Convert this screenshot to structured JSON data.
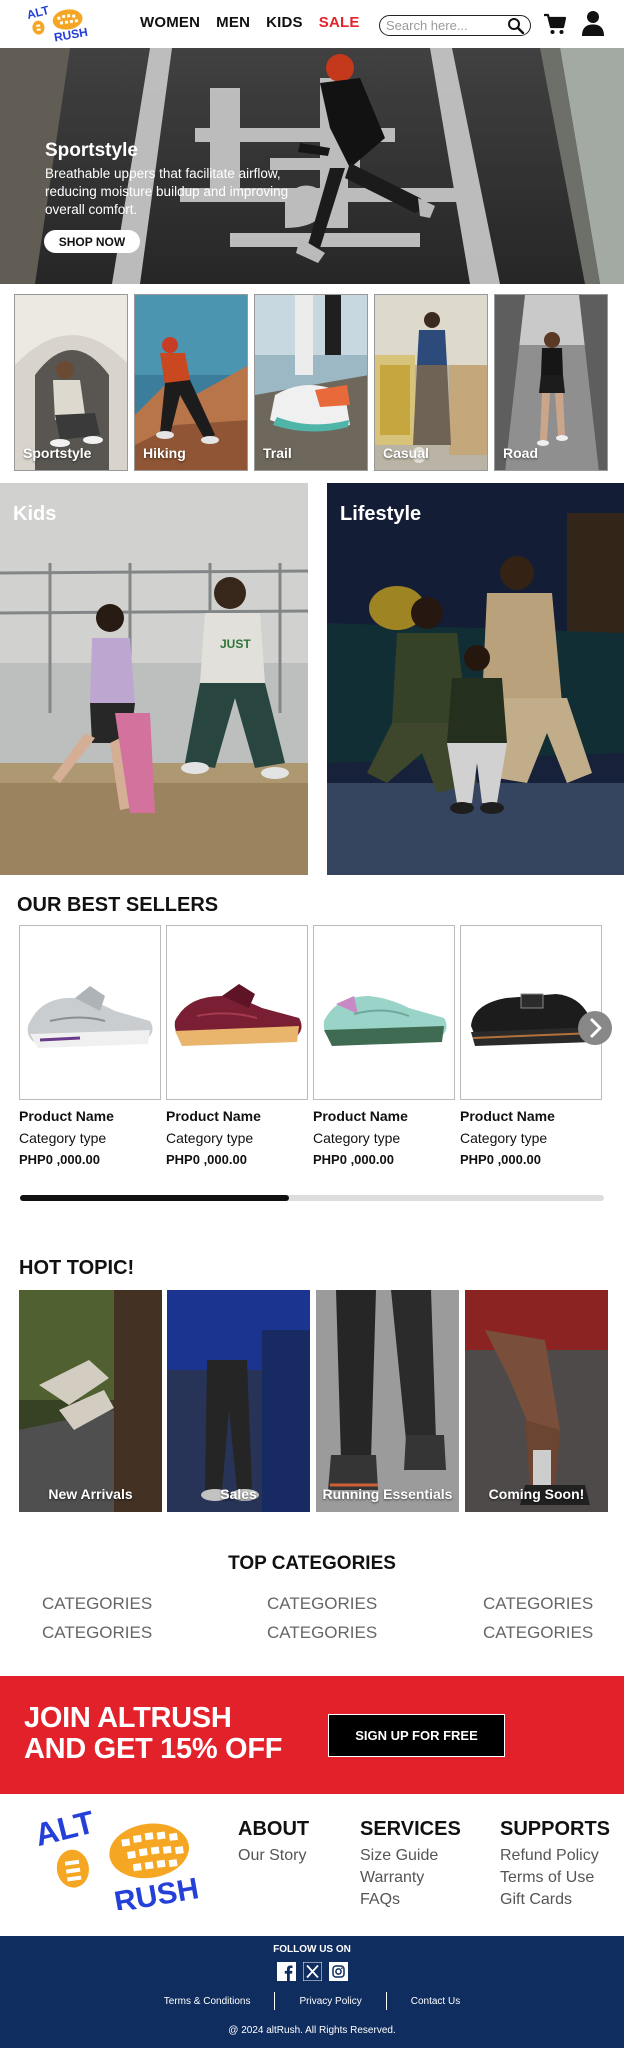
{
  "header": {
    "logo_text_top": "ALT",
    "logo_text_bottom": "RUSH",
    "nav": [
      "WOMEN",
      "MEN",
      "KIDS",
      "SALE"
    ],
    "search_placeholder": "Search here...",
    "icons": [
      "search-icon",
      "cart-icon",
      "user-icon"
    ]
  },
  "hero": {
    "title": "Sportstyle",
    "description": "Breathable uppers that facilitate airflow, reducing moisture buildup and improving overall comfort.",
    "cta": "SHOP NOW"
  },
  "activities": [
    "Sportstyle",
    "Hiking",
    "Trail",
    "Casual",
    "Road"
  ],
  "featured": {
    "left": "Kids",
    "right": "Lifestyle"
  },
  "best_sellers": {
    "title": "OUR BEST SELLERS",
    "products": [
      {
        "name": "Product Name",
        "category": "Category type",
        "price": "PHP0 ,000.00"
      },
      {
        "name": "Product Name",
        "category": "Category type",
        "price": "PHP0 ,000.00"
      },
      {
        "name": "Product Name",
        "category": "Category type",
        "price": "PHP0 ,000.00"
      },
      {
        "name": "Product Name",
        "category": "Category type",
        "price": "PHP0 ,000.00"
      }
    ],
    "scroll_progress": 0.46
  },
  "hot_topic": {
    "title": "HOT TOPIC!",
    "items": [
      "New Arrivals",
      "Sales",
      "Running Essentials",
      "Coming Soon!"
    ]
  },
  "top_categories": {
    "title": "TOP CATEGORIES",
    "items": [
      "CATEGORIES",
      "CATEGORIES",
      "CATEGORIES",
      "CATEGORIES",
      "CATEGORIES",
      "CATEGORIES"
    ]
  },
  "join": {
    "line1": "JOIN ALTRUSH",
    "line2": "AND GET 15% OFF",
    "cta": "SIGN UP FOR FREE"
  },
  "footer": {
    "about": {
      "title": "ABOUT",
      "links": [
        "Our Story"
      ]
    },
    "services": {
      "title": "SERVICES",
      "links": [
        "Size Guide",
        "Warranty",
        "FAQs"
      ]
    },
    "supports": {
      "title": "SUPPORTS",
      "links": [
        "Refund Policy",
        "Terms of Use",
        "Gift Cards"
      ]
    },
    "follow_label": "FOLLOW US ON",
    "social_icons": [
      "facebook-icon",
      "x-icon",
      "instagram-icon"
    ],
    "legal_links": [
      "Terms & Conditions",
      "Privacy Policy",
      "Contact Us"
    ],
    "copyright": "@ 2024 altRush. All Rights Reserved."
  },
  "colors": {
    "accent_red": "#e3232e",
    "footer_navy": "#0f2d5e",
    "logo_blue": "#2440d8",
    "logo_orange": "#f5a623"
  }
}
